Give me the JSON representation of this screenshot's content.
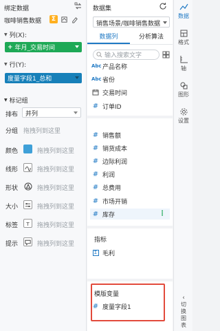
{
  "left_panel": {
    "title": "绑定数据",
    "dataset_name": "咖啡销售数据",
    "columns": {
      "label": "列(X):",
      "pill": "年月_交易时间",
      "pill_color": "#1ea956"
    },
    "rows": {
      "label": "行(Y):",
      "pill": "度量字段1_总和",
      "pill_color": "#1780b9"
    },
    "marks": {
      "title": "标记组",
      "arrange_label": "排布",
      "arrange_value": "并列",
      "group_label": "分组",
      "group_hint": "拖拽列到这里",
      "items": [
        {
          "label": "颜色",
          "icon": "color-swatch-icon",
          "hint": "拖拽列到这里"
        },
        {
          "label": "线形",
          "icon": "line-shape-icon",
          "hint": "拖拽列到这里"
        },
        {
          "label": "形状",
          "icon": "shape-icon",
          "hint": "拖拽列到这里"
        },
        {
          "label": "大小",
          "icon": "size-icon",
          "hint": "拖拽列到这里"
        },
        {
          "label": "标签",
          "icon": "label-icon",
          "hint": "拖拽列到这里"
        },
        {
          "label": "提示",
          "icon": "tooltip-icon",
          "hint": "拖拽列到这里"
        }
      ]
    }
  },
  "middle_panel": {
    "title": "数据集",
    "dataset_select": "销售场景/咖啡销售数据",
    "tabs": [
      "数据列",
      "分析算法"
    ],
    "active_tab": 0,
    "search_placeholder": "输入搜索文字",
    "dimensions": [
      {
        "type": "text",
        "name": "产品名称"
      },
      {
        "type": "text",
        "name": "省份"
      },
      {
        "type": "date",
        "name": "交易时间"
      },
      {
        "type": "number",
        "name": "订单ID"
      }
    ],
    "measures": [
      {
        "name": "销售额"
      },
      {
        "name": "销货成本"
      },
      {
        "name": "边际利润"
      },
      {
        "name": "利润"
      },
      {
        "name": "总费用"
      },
      {
        "name": "市场开销"
      },
      {
        "name": "库存"
      }
    ],
    "indicators_title": "指标",
    "indicators": [
      {
        "name": "毛利"
      }
    ],
    "variables_title": "模版变量",
    "variables": [
      {
        "name": "度量字段1"
      }
    ]
  },
  "right_strip": {
    "items": [
      {
        "label": "数据",
        "icon": "chart-line-icon",
        "active": true
      },
      {
        "label": "格式",
        "icon": "format-icon",
        "active": false
      },
      {
        "label": "轴",
        "icon": "axis-icon",
        "active": false
      },
      {
        "label": "图形",
        "icon": "graphics-icon",
        "active": false
      },
      {
        "label": "设置",
        "icon": "gear-icon",
        "active": false
      }
    ],
    "toggle_label": "切换图表",
    "accent": "#1f79c4",
    "highlight_border": "#e24a3b"
  }
}
